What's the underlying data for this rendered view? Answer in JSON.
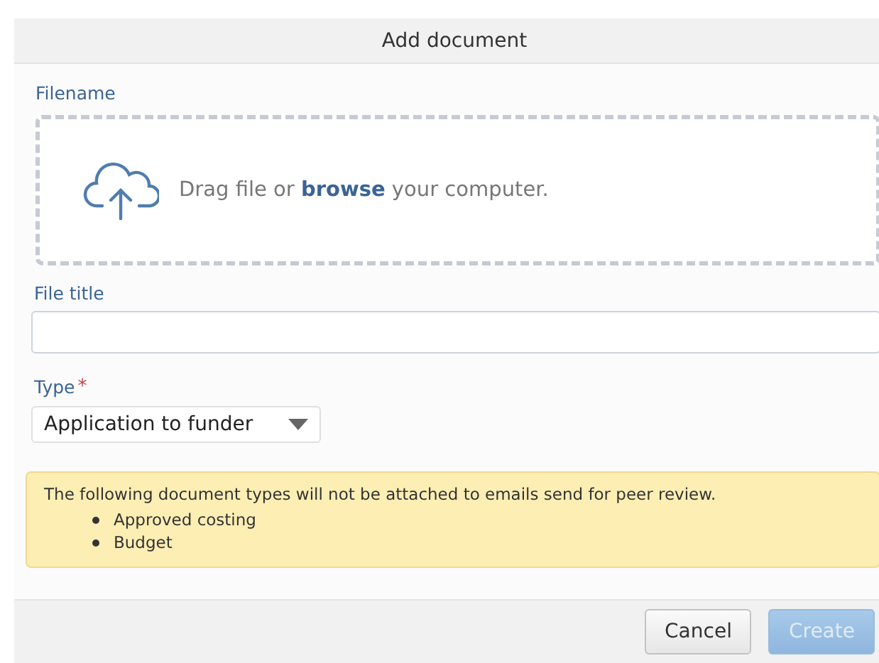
{
  "dialog": {
    "title": "Add document"
  },
  "filename": {
    "label": "Filename",
    "dropzone_text": "Drag file or **browse** your computer."
  },
  "file_title": {
    "label": "File title"
  },
  "type": {
    "label": "Type",
    "required_mark": "*",
    "value": "Application to funder"
  },
  "notice": {
    "text": "The following document types will not be attached to emails send for peer review.",
    "items": [
      "Approved costing",
      "Budget"
    ]
  },
  "buttons": [
    {
      "label": "Cancel",
      "kind": "secondary",
      "disabled": false
    },
    {
      "label": "Create",
      "kind": "primary",
      "disabled": true
    }
  ]
}
